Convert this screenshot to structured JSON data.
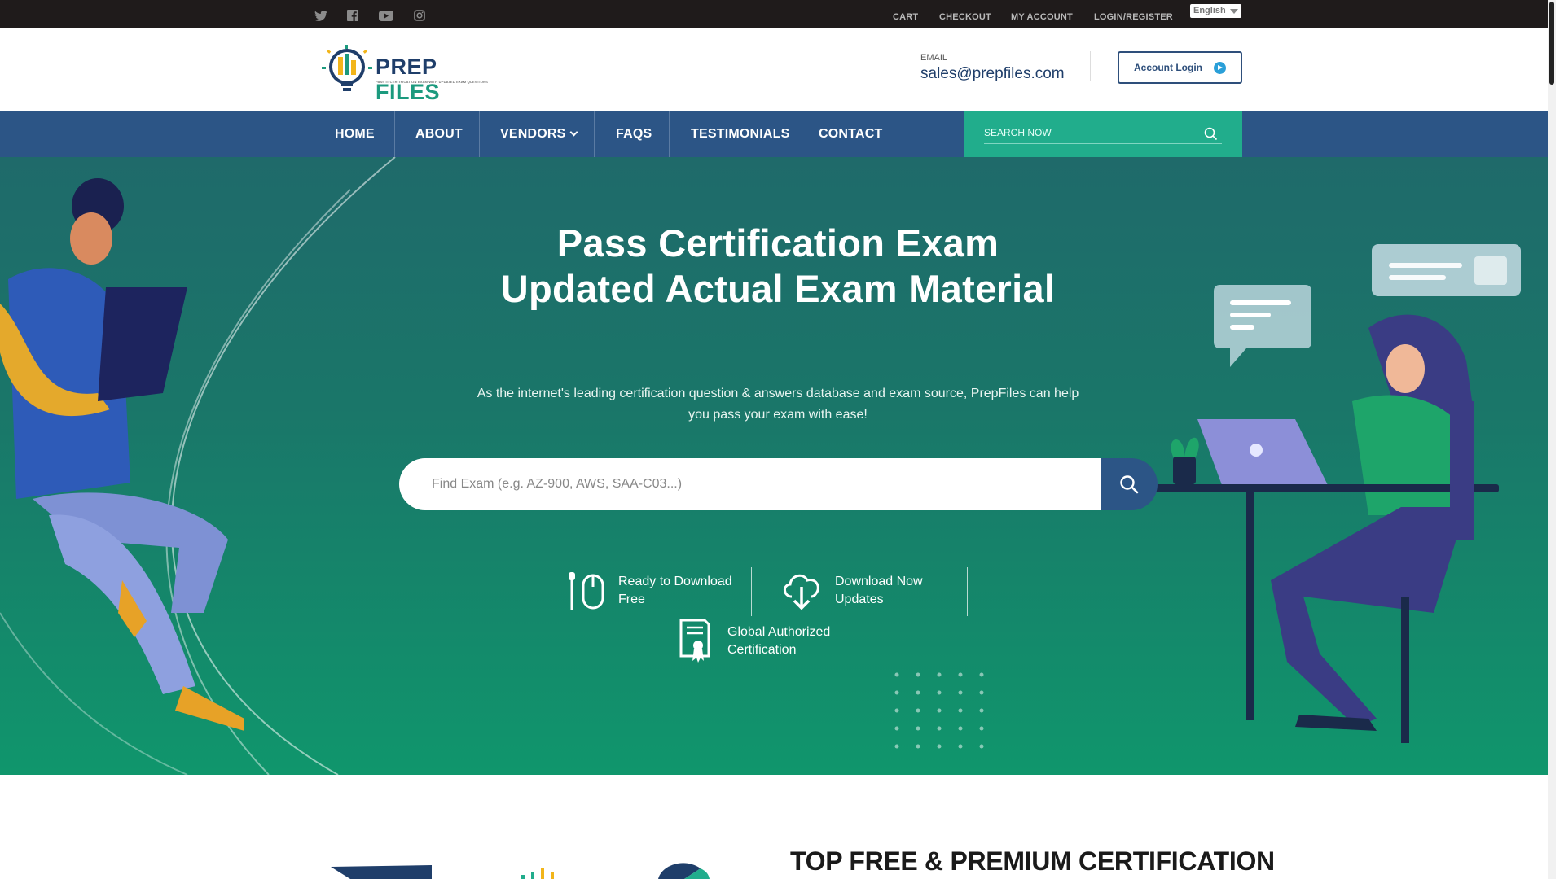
{
  "topbar": {
    "social": [
      "twitter-icon",
      "facebook-icon",
      "youtube-icon",
      "instagram-icon"
    ],
    "links": [
      "CART",
      "CHECKOUT",
      "MY ACCOUNT",
      "LOGIN/REGISTER"
    ],
    "language": "English"
  },
  "header": {
    "logo_word1": "PREP",
    "logo_word2": " FILES",
    "logo_tagline": "PASS IT CERTIFICATION EXAM WITH UPDATED EXAM QUESTIONS",
    "email_label": "EMAIL",
    "email_value": "sales@prepfiles.com",
    "account_button": "Account Login"
  },
  "nav": {
    "items": [
      "HOME",
      "ABOUT",
      "VENDORS",
      "FAQS",
      "TESTIMONIALS",
      "CONTACT"
    ],
    "search_placeholder": "SEARCH NOW"
  },
  "hero": {
    "title_line1": "Pass Certification Exam",
    "title_line2": "Updated Actual Exam Material",
    "subtitle": "As the internet's leading certification question & answers database and exam source, PrepFiles can help you pass your exam with ease!",
    "search_placeholder": "Find Exam (e.g. AZ-900, AWS, SAA-C03...)",
    "features": [
      {
        "line1": "Ready to Download",
        "line2": "Free",
        "icon": "mouse-icon"
      },
      {
        "line1": "Download Now",
        "line2": "Updates",
        "icon": "cloud-download-icon"
      },
      {
        "line1": "Global Authorized",
        "line2": "Certification",
        "icon": "certificate-icon"
      }
    ]
  },
  "section": {
    "title": "TOP FREE & PREMIUM CERTIFICATION"
  },
  "colors": {
    "topbar": "#1f1b1b",
    "nav": "#2c5586",
    "accent": "#21ad8c",
    "hero": "#157d6a"
  }
}
